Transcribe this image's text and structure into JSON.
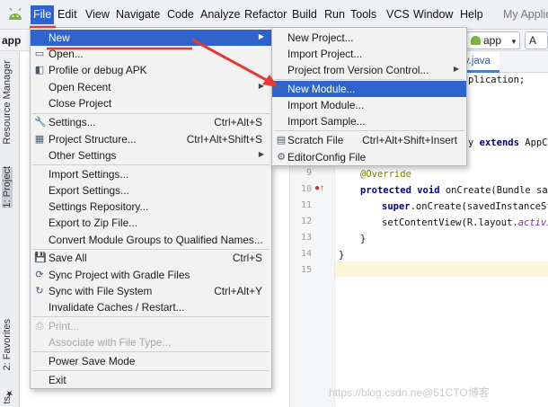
{
  "menubar": {
    "items": [
      "File",
      "Edit",
      "View",
      "Navigate",
      "Code",
      "Analyze",
      "Refactor",
      "Build",
      "Run",
      "Tools",
      "VCS",
      "Window",
      "Help"
    ],
    "title": "My Applic"
  },
  "navbar": {
    "project": "app",
    "run_config": "app",
    "run_button": "A"
  },
  "left_tabs": {
    "resource_manager": "Resource Manager",
    "project": "1: Project",
    "favorites": "2: Favorites",
    "bottom": "ts"
  },
  "file_menu": {
    "new": "New",
    "open": "Open...",
    "profile": "Profile or debug APK",
    "open_recent": "Open Recent",
    "close_project": "Close Project",
    "settings": "Settings...",
    "settings_sc": "Ctrl+Alt+S",
    "project_structure": "Project Structure...",
    "project_structure_sc": "Ctrl+Alt+Shift+S",
    "other_settings": "Other Settings",
    "import_settings": "Import Settings...",
    "export_settings": "Export Settings...",
    "settings_repository": "Settings Repository...",
    "export_zip": "Export to Zip File...",
    "convert_module": "Convert Module Groups to Qualified Names...",
    "save_all": "Save All",
    "save_all_sc": "Ctrl+S",
    "sync_gradle": "Sync Project with Gradle Files",
    "sync_fs": "Sync with File System",
    "sync_fs_sc": "Ctrl+Alt+Y",
    "invalidate": "Invalidate Caches / Restart...",
    "print": "Print...",
    "associate": "Associate with File Type...",
    "power_save": "Power Save Mode",
    "exit": "Exit"
  },
  "new_submenu": {
    "new_project": "New Project...",
    "import_project": "Import Project...",
    "project_from_vc": "Project from Version Control...",
    "new_module": "New Module...",
    "import_module": "Import Module...",
    "import_sample": "Import Sample...",
    "scratch_file": "Scratch File",
    "scratch_file_sc": "Ctrl+Alt+Shift+Insert",
    "editorconfig": "EditorConfig File"
  },
  "editor": {
    "tab": "ity.java",
    "line_numbers": [
      "9",
      "10",
      "11",
      "12",
      "13",
      "14",
      "15"
    ],
    "code_import": "plication;",
    "code_class_pre": "y ",
    "code_class_kw": "extends",
    "code_class_post": " AppCo",
    "code_override": "@Override",
    "code_protected": "protected",
    "code_void": "void",
    "code_oncreate": " onCreate(Bundle save",
    "code_super": "super",
    "code_super_rest": ".onCreate(savedInstanceSta",
    "code_setcontent": "setContentView(R.layout.",
    "code_setcontent_it": "activit",
    "code_close_inner": "}",
    "code_close_outer": "}"
  },
  "watermark": "https://blog.csdn.ne@51CTO博客",
  "colors": {
    "selection": "#2f65ca",
    "arrow": "#e53935",
    "menu_bg": "#f2f2f2"
  }
}
